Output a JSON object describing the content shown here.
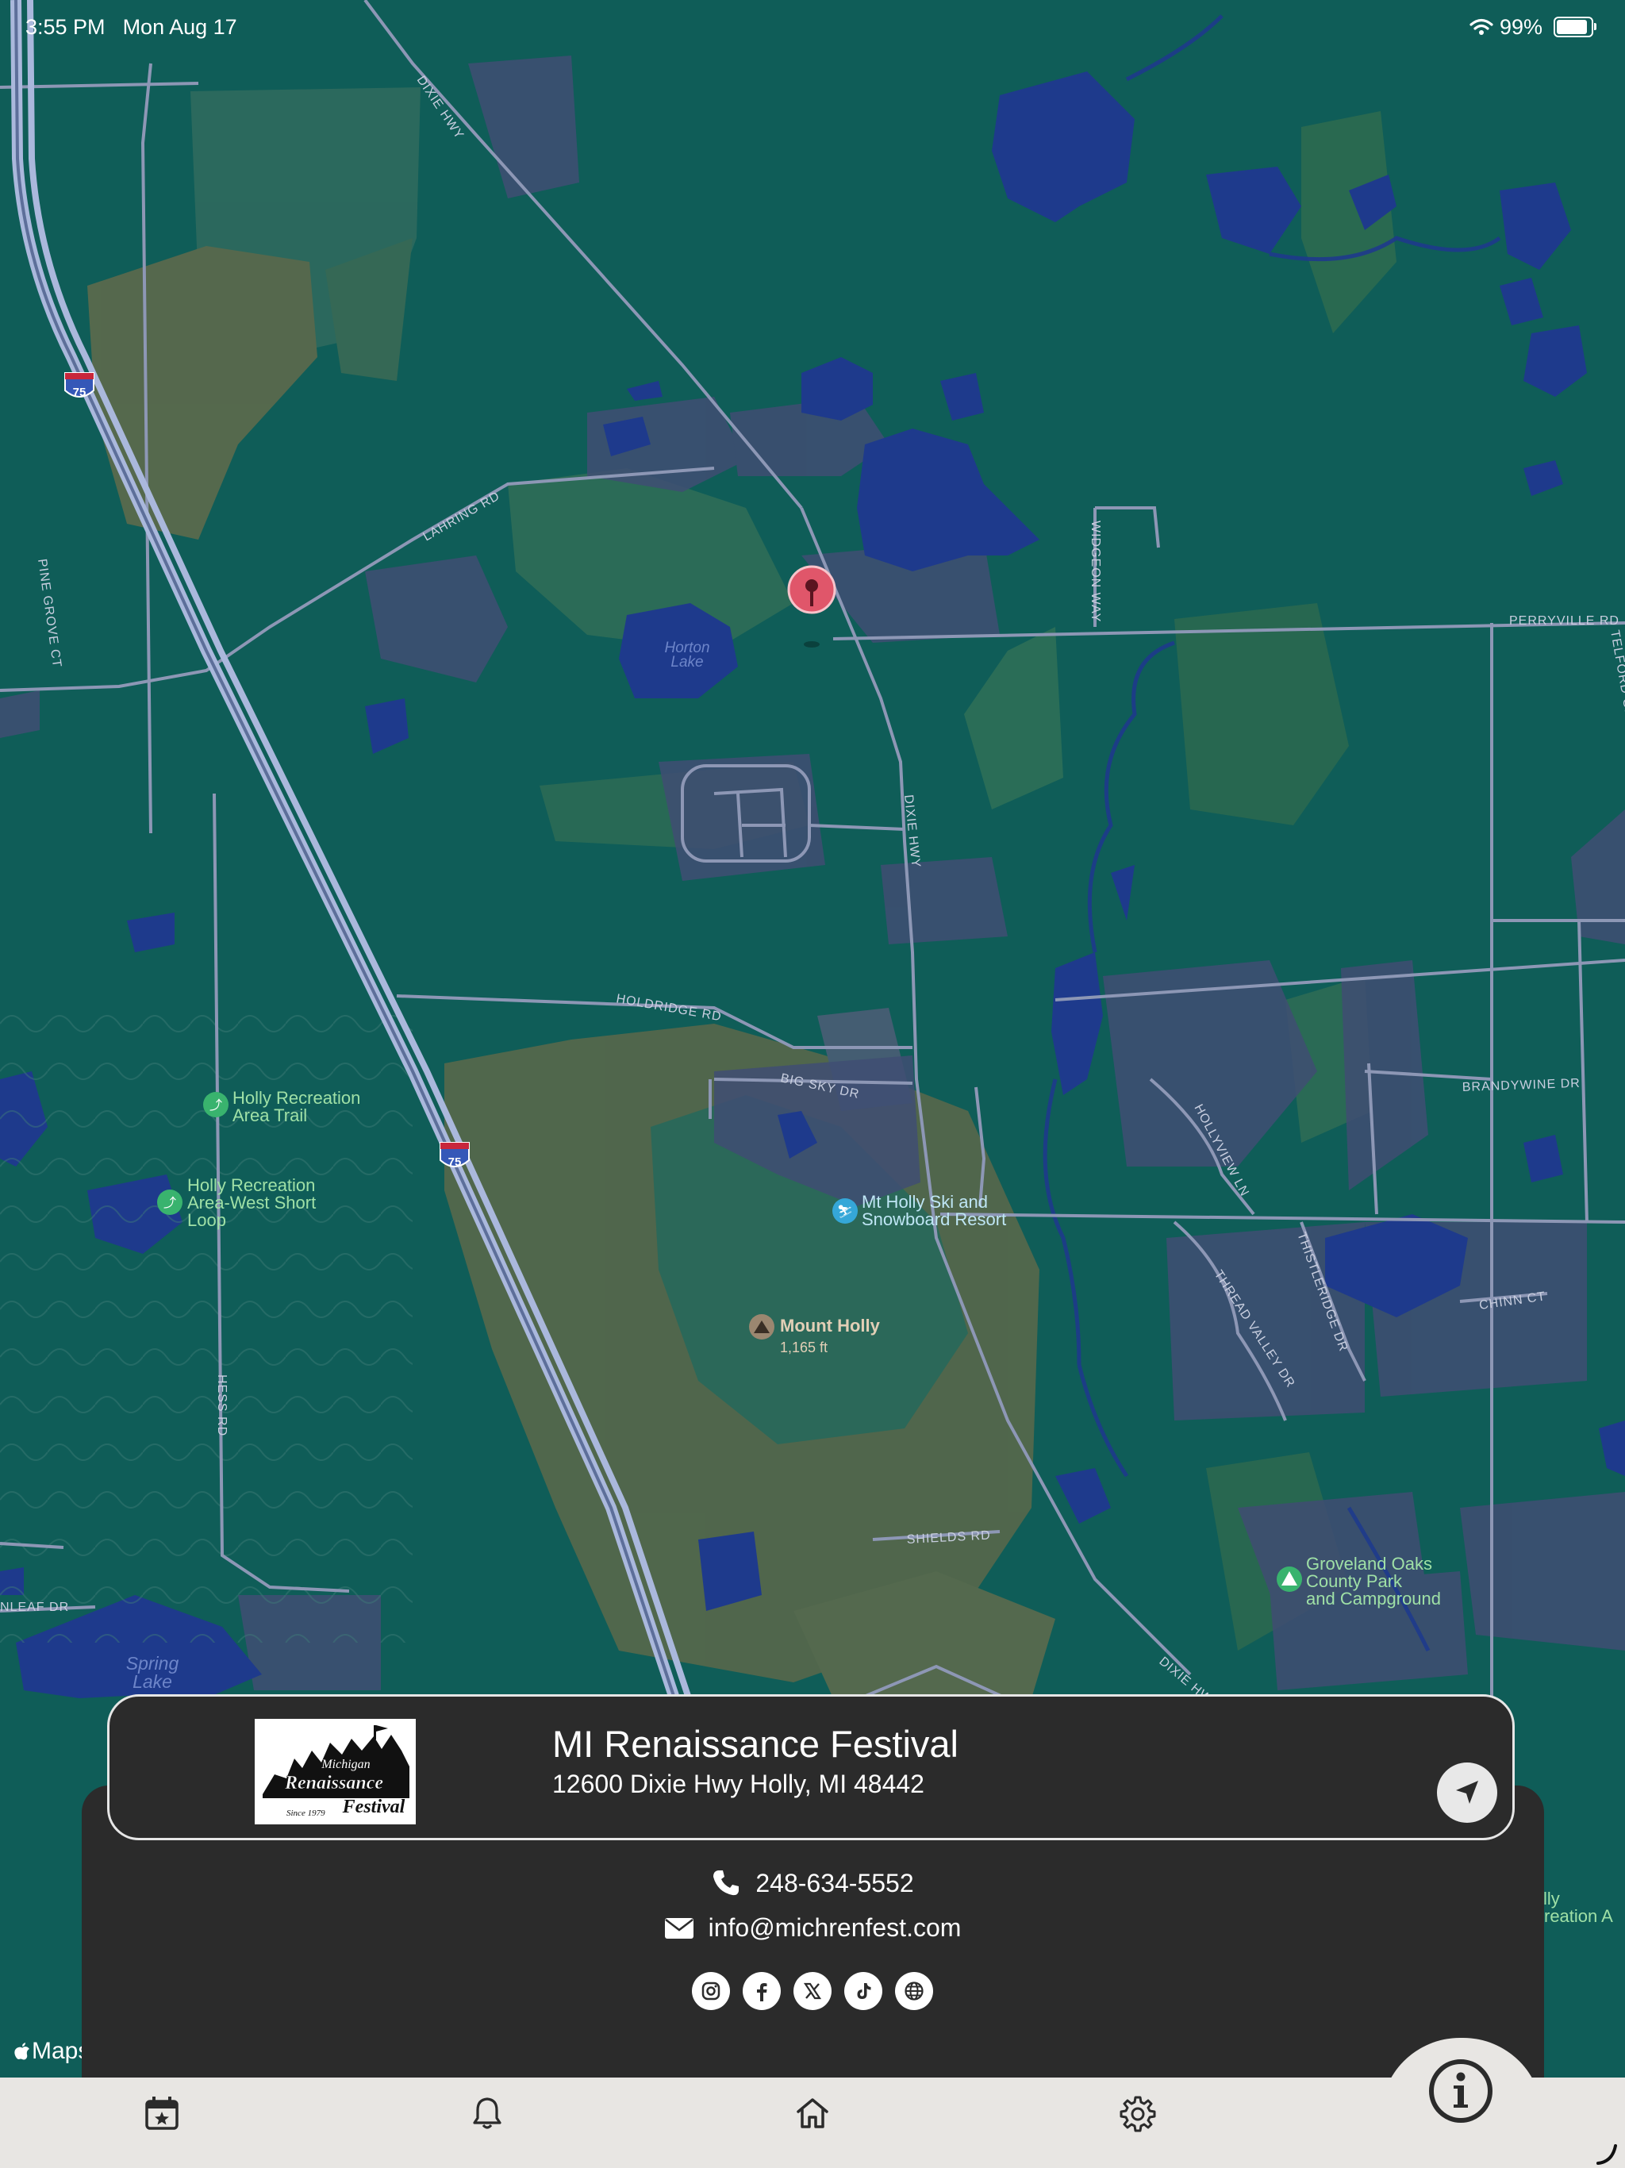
{
  "status_bar": {
    "time": "3:55 PM",
    "date": "Mon Aug 17",
    "battery": "99%",
    "battery_level": 0.99
  },
  "map": {
    "attribution": "Maps",
    "road_labels": {
      "dixie_hwy": "DIXIE HWY",
      "lahring_rd": "LAHRING RD",
      "pine_grove_ct": "PINE GROVE CT",
      "widgeon_way": "WIDGEON WAY",
      "perryville_rd": "PERRYVILLE RD",
      "telford_grove": "TELFORD GROVE",
      "holdridge_rd": "HOLDRIDGE RD",
      "big_sky_dr": "BIG SKY DR",
      "hollyview_ln": "HOLLYVIEW LN",
      "brandywine_dr": "BRANDYWINE DR",
      "thistleridge_dr": "THISTLERIDGE DR",
      "thread_valley_dr": "THREAD VALLEY DR",
      "chinn_ct": "CHINN CT",
      "hess_rd": "HESS RD",
      "shields_rd": "SHIELDS RD",
      "leaf_dr": "NLEAF DR",
      "highway_shield": "75"
    },
    "water_labels": {
      "horton_lake_1": "Horton",
      "horton_lake_2": "Lake",
      "spring_lake_1": "Spring",
      "spring_lake_2": "Lake"
    },
    "pois": {
      "holly_trail_1": "Holly Recreation",
      "holly_trail_2": "Area Trail",
      "west_loop_1": "Holly Recreation",
      "west_loop_2": "Area-West Short",
      "west_loop_3": "Loop",
      "ski_resort_1": "Mt Holly Ski and",
      "ski_resort_2": "Snowboard Resort",
      "mount_holly": "Mount Holly",
      "mount_holly_elev": "1,165 ft",
      "groveland_1": "Groveland Oaks",
      "groveland_2": "County Park",
      "groveland_3": "and Campground",
      "edge_1": "lly",
      "edge_2": "creation A"
    }
  },
  "place": {
    "logo_text_top": "Michigan",
    "logo_text_main": "Renaissance",
    "logo_text_festival": "Festival",
    "logo_text_since": "Since 1979",
    "name": "MI Renaissance Festival",
    "address": "12600 Dixie Hwy Holly, MI 48442",
    "phone": "248-634-5552",
    "email": "info@michrenfest.com",
    "socials": [
      "instagram-icon",
      "facebook-icon",
      "x-icon",
      "tiktok-icon",
      "globe-icon"
    ]
  },
  "tabs": [
    "calendar-star-icon",
    "bell-icon",
    "home-icon",
    "gear-icon",
    "info-icon"
  ],
  "colors": {
    "map_base": "#0f5d58",
    "water": "#1e3a8c",
    "panel": "#2b2b2b",
    "tabbar": "#e8e6e3",
    "pin": "#e0566a"
  }
}
